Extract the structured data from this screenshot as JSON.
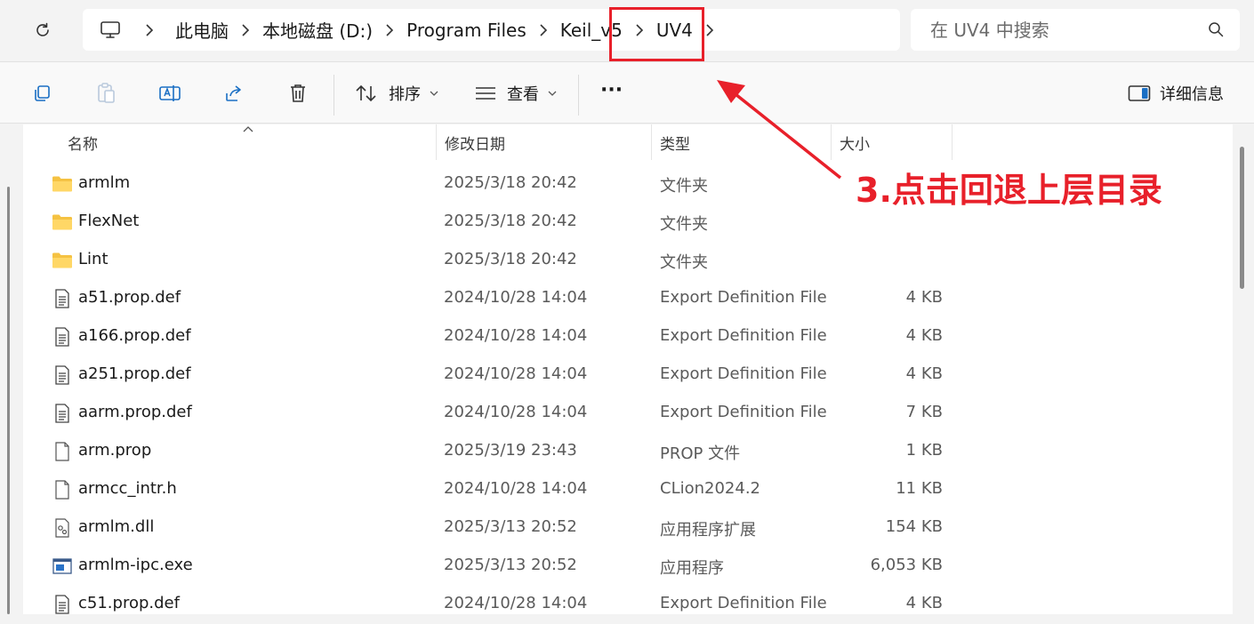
{
  "address_bar": {
    "breadcrumbs": [
      "此电脑",
      "本地磁盘 (D:)",
      "Program Files",
      "Keil_v5",
      "UV4"
    ],
    "pc_icon": "monitor-icon",
    "refresh_icon": "refresh-icon"
  },
  "search": {
    "placeholder": "在 UV4 中搜索",
    "icon": "search-icon"
  },
  "commandbar": {
    "icons": [
      "copy-icon",
      "paste-icon",
      "rename-icon",
      "share-icon",
      "delete-icon"
    ],
    "sort_label": "排序",
    "view_label": "查看",
    "more_label": "···",
    "details_label": "详细信息"
  },
  "columns": {
    "name": "名称",
    "date": "修改日期",
    "type": "类型",
    "size": "大小"
  },
  "files": [
    {
      "name": "armlm",
      "date": "2025/3/18 20:42",
      "type": "文件夹",
      "size": "",
      "icon": "folder-icon"
    },
    {
      "name": "FlexNet",
      "date": "2025/3/18 20:42",
      "type": "文件夹",
      "size": "",
      "icon": "folder-icon"
    },
    {
      "name": "Lint",
      "date": "2025/3/18 20:42",
      "type": "文件夹",
      "size": "",
      "icon": "folder-icon"
    },
    {
      "name": "a51.prop.def",
      "date": "2024/10/28 14:04",
      "type": "Export Definition File",
      "size": "4 KB",
      "icon": "text-file-icon"
    },
    {
      "name": "a166.prop.def",
      "date": "2024/10/28 14:04",
      "type": "Export Definition File",
      "size": "4 KB",
      "icon": "text-file-icon"
    },
    {
      "name": "a251.prop.def",
      "date": "2024/10/28 14:04",
      "type": "Export Definition File",
      "size": "4 KB",
      "icon": "text-file-icon"
    },
    {
      "name": "aarm.prop.def",
      "date": "2024/10/28 14:04",
      "type": "Export Definition File",
      "size": "7 KB",
      "icon": "text-file-icon"
    },
    {
      "name": "arm.prop",
      "date": "2025/3/19 23:43",
      "type": "PROP 文件",
      "size": "1 KB",
      "icon": "blank-file-icon"
    },
    {
      "name": "armcc_intr.h",
      "date": "2024/10/28 14:04",
      "type": "CLion2024.2",
      "size": "11 KB",
      "icon": "blank-file-icon"
    },
    {
      "name": "armlm.dll",
      "date": "2025/3/13 20:52",
      "type": "应用程序扩展",
      "size": "154 KB",
      "icon": "dll-file-icon"
    },
    {
      "name": "armlm-ipc.exe",
      "date": "2025/3/13 20:52",
      "type": "应用程序",
      "size": "6,053 KB",
      "icon": "exe-file-icon"
    },
    {
      "name": "c51.prop.def",
      "date": "2024/10/28 14:04",
      "type": "Export Definition File",
      "size": "4 KB",
      "icon": "text-file-icon"
    }
  ],
  "annotation": {
    "text": "3.点击回退上层目录",
    "color": "#e8202a"
  }
}
